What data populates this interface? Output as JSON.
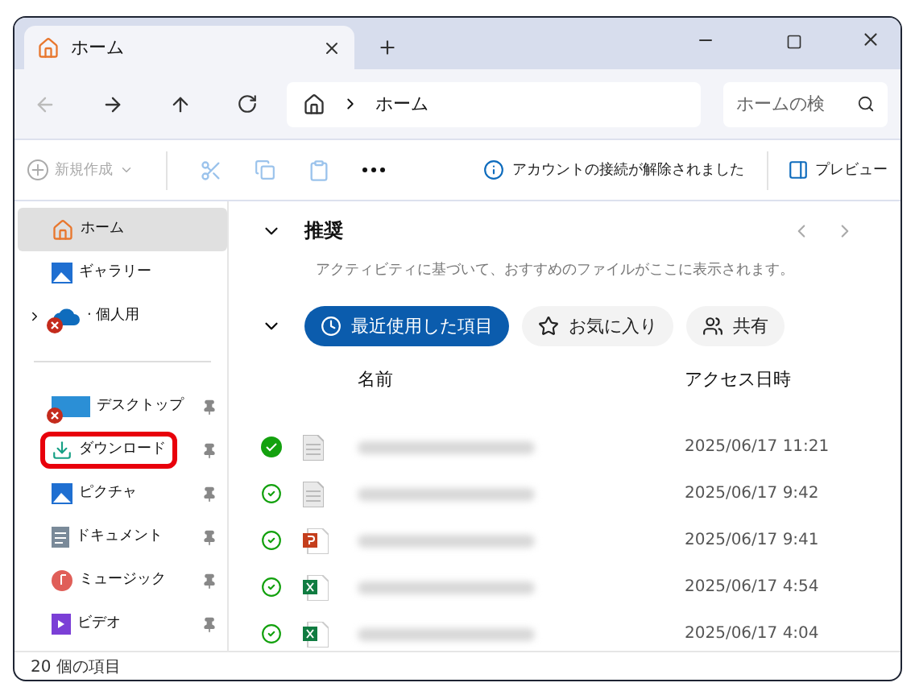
{
  "tabs": [
    {
      "label": "ホーム",
      "selected": true
    }
  ],
  "address": {
    "location": "ホーム"
  },
  "search": {
    "placeholder": "ホームの検"
  },
  "toolbar": {
    "new_label": "新規作成",
    "new_disabled": true,
    "notice": "アカウントの接続が解除されました",
    "preview_label": "プレビュー"
  },
  "sidebar": {
    "items": [
      {
        "kind": "home",
        "label": "ホーム",
        "selected": true,
        "pinned": false,
        "error": false,
        "highlighted": false,
        "expandable": false
      },
      {
        "kind": "gallery",
        "label": "ギャラリー",
        "selected": false,
        "pinned": false,
        "error": false,
        "highlighted": false,
        "expandable": false
      },
      {
        "kind": "cloud",
        "label": "· 個人用",
        "selected": false,
        "pinned": false,
        "error": true,
        "highlighted": false,
        "expandable": true
      },
      {
        "kind": "separator"
      },
      {
        "kind": "desktop",
        "label": "デスクトップ",
        "selected": false,
        "pinned": true,
        "error": true,
        "highlighted": false,
        "expandable": false
      },
      {
        "kind": "download",
        "label": "ダウンロード",
        "selected": false,
        "pinned": true,
        "error": false,
        "highlighted": true,
        "expandable": false
      },
      {
        "kind": "pictures",
        "label": "ピクチャ",
        "selected": false,
        "pinned": true,
        "error": false,
        "highlighted": false,
        "expandable": false
      },
      {
        "kind": "documents",
        "label": "ドキュメント",
        "selected": false,
        "pinned": true,
        "error": false,
        "highlighted": false,
        "expandable": false
      },
      {
        "kind": "music",
        "label": "ミュージック",
        "selected": false,
        "pinned": true,
        "error": false,
        "highlighted": false,
        "expandable": false
      },
      {
        "kind": "videos",
        "label": "ビデオ",
        "selected": false,
        "pinned": true,
        "error": false,
        "highlighted": false,
        "expandable": false
      }
    ]
  },
  "recommended": {
    "title": "推奨",
    "description": "アクティビティに基づいて、おすすめのファイルがここに表示されます。"
  },
  "filters": [
    {
      "label": "最近使用した項目",
      "kind": "recent",
      "selected": true
    },
    {
      "label": "お気に入り",
      "kind": "favorites",
      "selected": false
    },
    {
      "label": "共有",
      "kind": "shared",
      "selected": false
    }
  ],
  "table": {
    "columns": [
      "名前",
      "アクセス日時"
    ],
    "rows": [
      {
        "pinned": true,
        "kind": "text",
        "date": "2025/06/17 11:21"
      },
      {
        "pinned": false,
        "kind": "text",
        "date": "2025/06/17 9:42"
      },
      {
        "pinned": false,
        "kind": "powerpoint",
        "date": "2025/06/17 9:41"
      },
      {
        "pinned": false,
        "kind": "excel",
        "date": "2025/06/17 4:54"
      },
      {
        "pinned": false,
        "kind": "excel",
        "date": "2025/06/17 4:04"
      }
    ]
  },
  "status_bar": {
    "count": "20 個の項目"
  }
}
